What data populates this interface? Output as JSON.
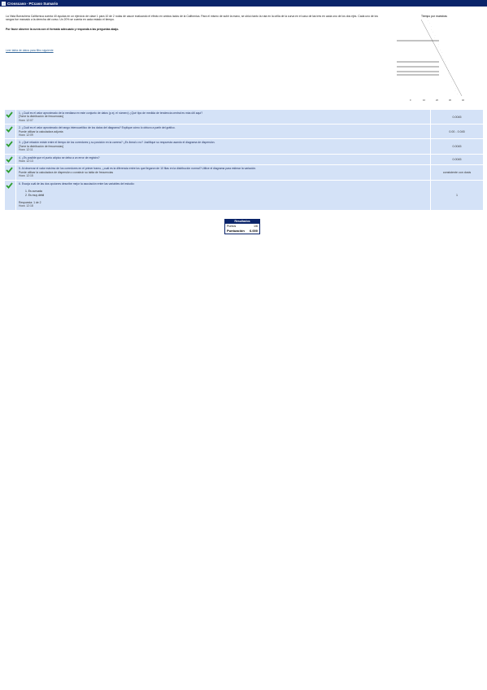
{
  "window": {
    "title_left": "Crosscaso",
    "title_right": "PCcaso Sumario"
  },
  "intro": {
    "paragraph": "La Vista Borrachera Californica cuenta 40 ayudas en un ejercicio de clase 1 para 10 de 2 rodas de cauce evaluando el efecto en ambos lados de la Californica. Para el mismo de subir la mano, se ubicó tanto la ruta en la orilla de la curva en el caso de las tres en cada uno de los dos ejes. Cada uno de los rangos fue marcado a la derecha del curso. Un 20% se cuenta en cada estado el tiempo.",
    "paragraph2": "Por favor observe la curva con el formato adecuado y responda a las preguntas abajo.",
    "link_label": "Leer tabla de datos para filtro siguiente"
  },
  "chart_data": {
    "type": "scatter",
    "title": "Tiempo por muestras",
    "x_ticks": [
      "0",
      "10",
      "20",
      "30",
      "40"
    ],
    "points_label_count": 26
  },
  "questions": [
    {
      "main": "1. ¿Cuál es el valor aproximado de la mediana en este conjunto de datos (p.ej. el número) ¿Qué tipo de medida de tendencia central es más útil aquí?",
      "extra": "[Tome la distribución de frecuencias]",
      "time": "Hora: 12:07",
      "answer": "0.0045"
    },
    {
      "main": "2. ¿Cuál es el valor aproximado del rango intercuartílico de los datos del diagrama? Explique cómo lo obtuvo a partir del gráfico.",
      "extra": "Puede utilizar la calculadora adjunta",
      "time": "Hora: 12:09",
      "answer": "0.00 - 0.045"
    },
    {
      "main": "3. ¿Qué relación existe entre el tiempo de los corredores y su posición en la carrera? ¿Es lineal o no? Justifique su respuesta usando el diagrama de dispersión.",
      "extra": "[Tome la distribución de frecuencias]",
      "time": "Hora: 12:11",
      "answer": "0.0045"
    },
    {
      "main": "4. ¿Es posible que el punto atípico se deba a un error de registro?",
      "extra": "",
      "time": "Hora: 12:13",
      "answer": "0.0045"
    },
    {
      "main": "5. Al observar el valor máximo de los corredores en el primer tramo, ¿cuál es la diferencia entre los que llegaron de 10 filas en la distribución normal? Utilice el diagrama para estimar la variación.",
      "extra": "Puede utilizar la calculadora de dispersión o construir su tabla de frecuencias",
      "time": "Hora: 12:15",
      "answer": "consistente con dosis"
    },
    {
      "main": "6. Escoja cuál de las dos opciones describe mejor la asociación entre las variables del estudio:",
      "options": [
        "1. Es curvada",
        "2. Es muy débil"
      ],
      "extra": "Respuesta: 1 de 2",
      "time": "Hora: 12:18",
      "answer": "1"
    }
  ],
  "score": {
    "header": "Resultados",
    "rows": [
      {
        "label": "Puntos",
        "value": "1/6"
      },
      {
        "label": "Puntuación",
        "value": "6.000"
      }
    ]
  },
  "colors": {
    "title_bar": "#0a246a",
    "row_bg": "#d4e2f7",
    "check_green": "#2e9e2e"
  },
  "icons": {
    "check": "check-icon",
    "window": "window-icon"
  }
}
